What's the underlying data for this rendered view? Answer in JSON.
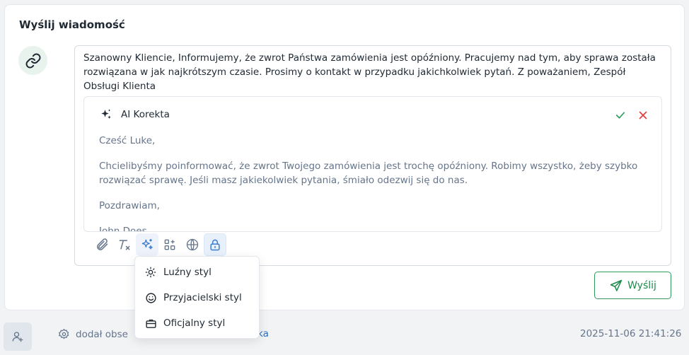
{
  "card": {
    "title": "Wyślij wiadomość"
  },
  "compose": {
    "message": "Szanowny Kliencie, Informujemy, że zwrot Państwa zamówienia jest opóźniony. Pracujemy nad tym, aby sprawa została rozwiązana w jak najkrótszym czasie. Prosimy o kontakt w przypadku jakichkolwiek pytań. Z poważaniem, Zespół Obsługi Klienta"
  },
  "ai": {
    "title": "AI Korekta",
    "greeting": "Cześć Luke,",
    "body": "Chcielibyśmy poinformować, że zwrot Twojego zamówienia jest trochę opóźniony. Robimy wszystko, żeby szybko rozwiązać sprawę. Jeśli masz jakiekolwiek pytania, śmiało odezwij się do nas.",
    "closing": "Pozdrawiam,",
    "signature": "John Does"
  },
  "toolbar": {
    "icons": [
      "paperclip-icon",
      "clear-format-icon",
      "sparkles-icon",
      "apps-icon",
      "globe-icon",
      "lock-icon"
    ]
  },
  "send": {
    "label": "Wyślij"
  },
  "dropdown": {
    "items": [
      {
        "label": "Luźny styl",
        "icon": "sun-icon"
      },
      {
        "label": "Przyjacielski styl",
        "icon": "smile-icon"
      },
      {
        "label": "Oficjalny styl",
        "icon": "briefcase-icon"
      }
    ]
  },
  "timeline": {
    "text": "dodał obse",
    "text_tail": "ka",
    "timestamp": "2025-11-06 21:41:26"
  },
  "colors": {
    "accent_green": "#2e9a5c",
    "reject_red": "#e03b3b",
    "link_blue": "#1f6fc9"
  }
}
